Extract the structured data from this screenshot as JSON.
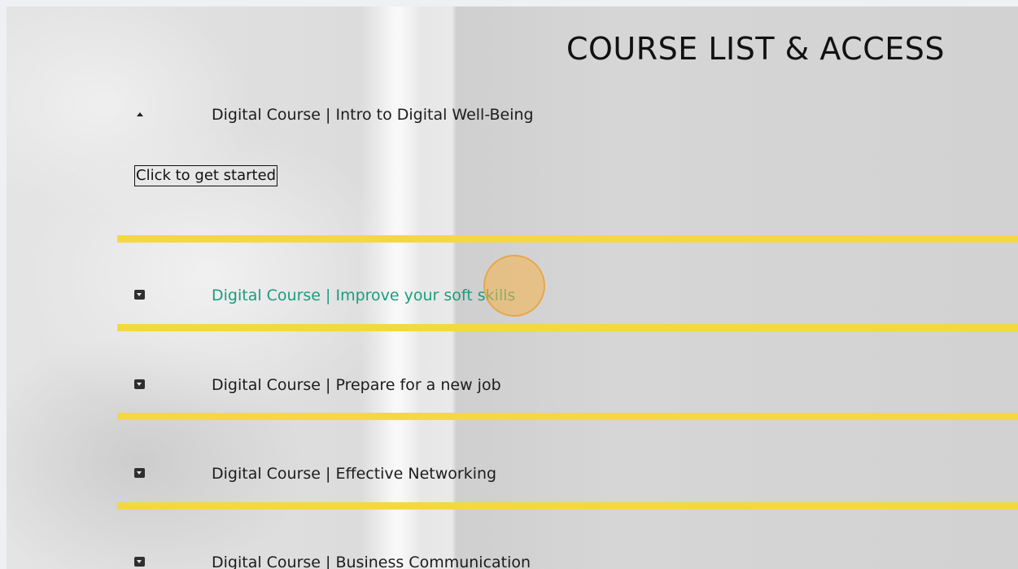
{
  "page": {
    "title": "COURSE LIST & ACCESS"
  },
  "courses": [
    {
      "title": "Digital Course | Intro to Digital Well-Being",
      "expanded": true,
      "cta_label": "Click to get started"
    },
    {
      "title": "Digital Course | Improve your soft skills",
      "expanded": false,
      "active": true
    },
    {
      "title": "Digital Course | Prepare for a new job",
      "expanded": false
    },
    {
      "title": "Digital Course | Effective Networking",
      "expanded": false
    },
    {
      "title": "Digital Course | Business Communication",
      "expanded": false
    }
  ],
  "colors": {
    "divider": "#f4d842",
    "active_link": "#1a9d7e",
    "cursor_highlight": "#f6b248"
  },
  "icons": {
    "expanded": "caret-up-icon",
    "collapsed": "caret-down-box-icon"
  }
}
